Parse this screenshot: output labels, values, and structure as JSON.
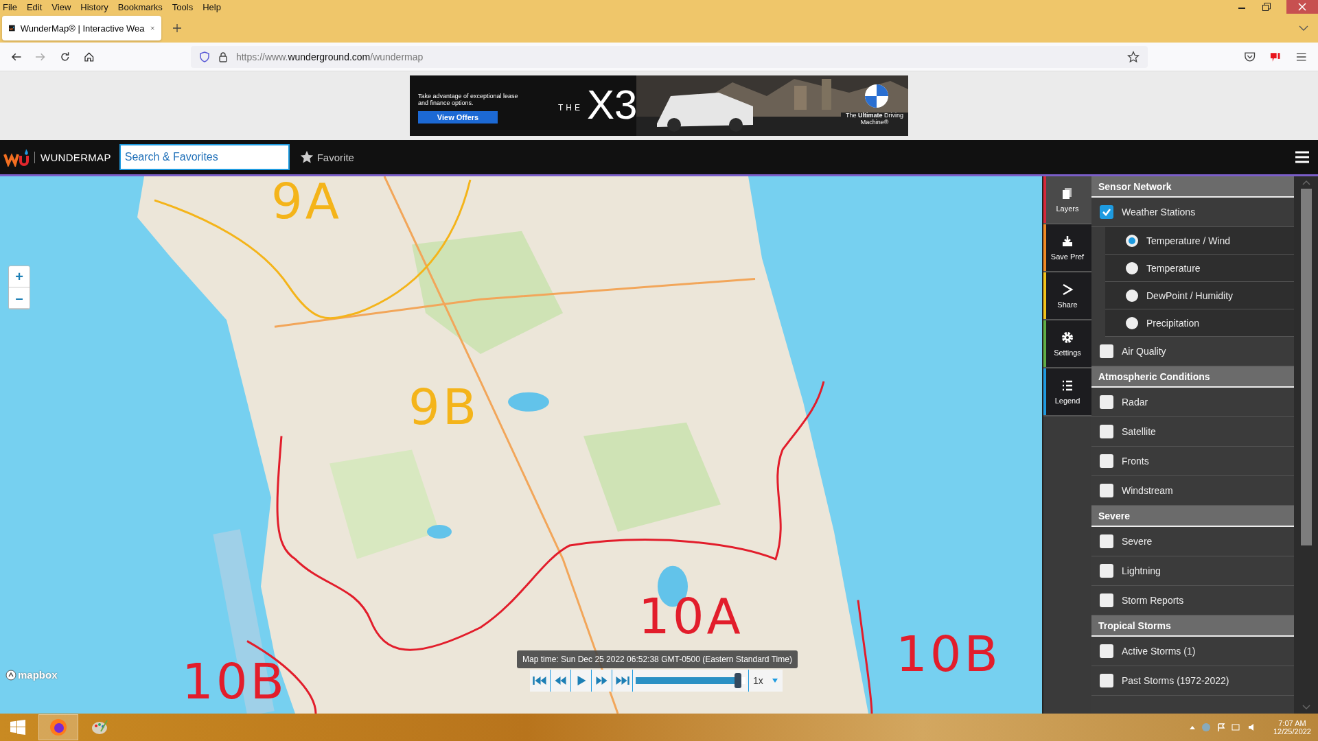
{
  "browser": {
    "menu": [
      "File",
      "Edit",
      "View",
      "History",
      "Bookmarks",
      "Tools",
      "Help"
    ],
    "tab": {
      "title": "WunderMap® | Interactive Wea",
      "selected": true
    },
    "url": {
      "scheme": "https://www.",
      "host": "wunderground.com",
      "path": "/wundermap"
    }
  },
  "ad": {
    "text": "Take advantage of exceptional lease and finance options.",
    "button": "View Offers",
    "the": "THE",
    "model": "X3",
    "tagline": "The **Ultimate** Driving Machine®"
  },
  "app": {
    "logo": "WUNDERMAP",
    "search": {
      "placeholder": "Search & Favorites"
    },
    "favorite": "Favorite"
  },
  "map": {
    "zoom": [
      "+",
      "–"
    ],
    "attribution": "mapbox",
    "annotations": [
      {
        "text": "9A",
        "color": "#f4b41a"
      },
      {
        "text": "9B",
        "color": "#f4b41a"
      },
      {
        "text": "10A",
        "color": "#e21d2b"
      },
      {
        "text": "10B",
        "color": "#e21d2b"
      },
      {
        "text": "10B",
        "color": "#e21d2b"
      }
    ],
    "timebar": {
      "time": "Map time: Sun Dec 25 2022 06:52:38 GMT-0500 (Eastern Standard Time)",
      "level": 0.96,
      "speed": "1x"
    }
  },
  "sidebar": {
    "tools": [
      {
        "label": "Layers",
        "selected": true,
        "color": "#d6283a"
      },
      {
        "label": "Save Pref",
        "selected": false,
        "color": "#f08a24"
      },
      {
        "label": "Share",
        "selected": false,
        "color": "#f2c318"
      },
      {
        "label": "Settings",
        "selected": false,
        "color": "#5fae46"
      },
      {
        "label": "Legend",
        "selected": false,
        "color": "#1e9be0"
      }
    ],
    "sections": [
      {
        "title": "Sensor Network",
        "items": [
          {
            "kind": "checkbox",
            "label": "Weather Stations",
            "checked": true
          },
          {
            "kind": "radio",
            "label": "Temperature / Wind",
            "selected": true
          },
          {
            "kind": "radio",
            "label": "Temperature",
            "selected": false
          },
          {
            "kind": "radio",
            "label": "DewPoint / Humidity",
            "selected": false
          },
          {
            "kind": "radio",
            "label": "Precipitation",
            "selected": false
          },
          {
            "kind": "checkbox",
            "label": "Air Quality",
            "checked": false
          }
        ]
      },
      {
        "title": "Atmospheric Conditions",
        "items": [
          {
            "kind": "checkbox",
            "label": "Radar",
            "checked": false
          },
          {
            "kind": "checkbox",
            "label": "Satellite",
            "checked": false
          },
          {
            "kind": "checkbox",
            "label": "Fronts",
            "checked": false
          },
          {
            "kind": "checkbox",
            "label": "Windstream",
            "checked": false
          }
        ]
      },
      {
        "title": "Severe",
        "items": [
          {
            "kind": "checkbox",
            "label": "Severe",
            "checked": false
          },
          {
            "kind": "checkbox",
            "label": "Lightning",
            "checked": false
          },
          {
            "kind": "checkbox",
            "label": "Storm Reports",
            "checked": false
          }
        ]
      },
      {
        "title": "Tropical Storms",
        "items": [
          {
            "kind": "checkbox",
            "label": "Active Storms (1)",
            "checked": false
          },
          {
            "kind": "checkbox",
            "label": "Past Storms (1972-2022)",
            "checked": false
          }
        ]
      }
    ]
  },
  "taskbar": {
    "time": "7:07 AM",
    "date": "12/25/2022"
  }
}
